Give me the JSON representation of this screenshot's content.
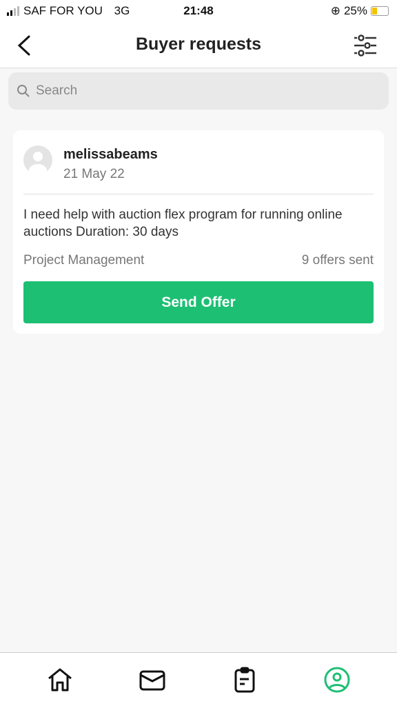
{
  "status": {
    "carrier": "SAF FOR YOU",
    "network": "3G",
    "time": "21:48",
    "battery": "25%",
    "signal_bars": 2
  },
  "header": {
    "title": "Buyer requests",
    "back_icon": "chevron-left-icon",
    "filter_icon": "sliders-icon"
  },
  "search": {
    "placeholder": "Search"
  },
  "requests": [
    {
      "username": "melissabeams",
      "date": "21 May 22",
      "description": "I need help with auction flex program for running online auctions Duration: 30 days",
      "category": "Project Management",
      "offers": "9 offers sent",
      "button": "Send Offer"
    }
  ],
  "tabbar": {
    "items": [
      "home",
      "inbox",
      "orders",
      "profile"
    ],
    "active": "profile",
    "active_color": "#1dbf73"
  },
  "colors": {
    "accent": "#1dbf73"
  }
}
